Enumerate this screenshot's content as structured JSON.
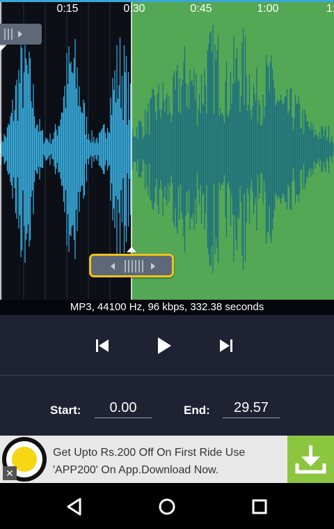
{
  "timeline": {
    "ticks": [
      "0:15",
      "0:30",
      "0:45",
      "1:00",
      "1:1"
    ]
  },
  "info": {
    "text": "MP3, 44100 Hz, 96 kbps, 332.38 seconds"
  },
  "times": {
    "start_label": "Start:",
    "start_value": "0.00",
    "end_label": "End:",
    "end_value": "29.57"
  },
  "ad": {
    "text_line1": "Get Upto Rs.200 Off On First Ride Use",
    "text_line2": "'APP200' On App.Download Now.",
    "close_glyph": "✕"
  },
  "colors": {
    "selected_wave": "#3ab3e8",
    "unselected_bg": "#54a755",
    "unselected_wave": "#1c6d80",
    "handle_highlight": "#f0c419",
    "ad_download_bg": "#8cc63f"
  }
}
